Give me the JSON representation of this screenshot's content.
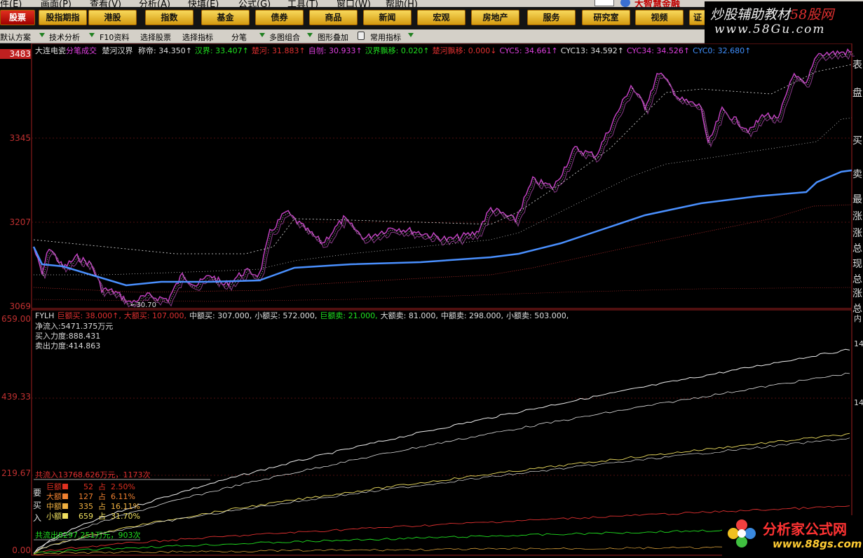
{
  "menubar": {
    "items": [
      "件(E)",
      "画面(P)",
      "查看(V)",
      "分析(A)",
      "快填(E)",
      "公式(G)",
      "工具(T)",
      "窗口(W)",
      "帮助(H)"
    ],
    "news": "大智慧金融"
  },
  "buttons": {
    "active": "股票",
    "items": [
      "股指期指",
      "港股",
      "指数",
      "基金",
      "债券",
      "商品",
      "新闻",
      "宏观",
      "房地产",
      "服务",
      "研究室",
      "视频",
      "证"
    ]
  },
  "toolbar": {
    "items": [
      "默认方案",
      "技术分析",
      "F10资料",
      "选择股票",
      "选择指标",
      "分笔",
      "多图组合",
      "图形叠加",
      "常用指标"
    ]
  },
  "watermark_top": {
    "line1_a": "炒股辅助教材",
    "line1_b": "58股网",
    "line2": "www.58Gu.com"
  },
  "watermark_bottom": {
    "title": "分析家公式网",
    "url": "www.88gs.com"
  },
  "price_panel": {
    "stock": "大连电瓷",
    "mode": "分笔成交",
    "indicator": "楚河汉界",
    "fields": [
      {
        "label": "称帝:",
        "value": "34.350",
        "arrow": "↑",
        "color": "#e0e0e0"
      },
      {
        "label": "汉界:",
        "value": "33.407",
        "arrow": "↑",
        "color": "#20e020"
      },
      {
        "label": "楚河:",
        "value": "31.883",
        "arrow": "↑",
        "color": "#e03030"
      },
      {
        "label": "自刎:",
        "value": "30.933",
        "arrow": "↑",
        "color": "#e040e0"
      },
      {
        "label": "汉界飘移:",
        "value": "0.020",
        "arrow": "↑",
        "color": "#20e020"
      },
      {
        "label": "楚河飘移:",
        "value": "0.000",
        "arrow": "↓",
        "color": "#e03030"
      },
      {
        "label": "CYC5:",
        "value": "34.661",
        "arrow": "↑",
        "color": "#e040e0"
      },
      {
        "label": "CYC13:",
        "value": "34.592",
        "arrow": "↑",
        "color": "#e0e0e0"
      },
      {
        "label": "CYC34:",
        "value": "34.526",
        "arrow": "↑",
        "color": "#e040e0"
      },
      {
        "label": "CYC0:",
        "value": "32.680",
        "arrow": "↑",
        "color": "#4090ff"
      }
    ],
    "yticks": [
      "3483",
      "3345",
      "3207",
      "3069"
    ],
    "low_label": "30.70",
    "side_text": [
      "表",
      "盘",
      "买",
      "卖",
      "最",
      "涨",
      "涨",
      "总",
      "现",
      "总",
      "涨",
      "总"
    ]
  },
  "flow_panel": {
    "header": [
      {
        "label": "FYLH",
        "value": "",
        "color": "#e0e0e0"
      },
      {
        "label": "巨额买:",
        "value": "38.000",
        "arrow": "↑",
        "color": "#e03030"
      },
      {
        "label": "大额买:",
        "value": "107.000",
        "arrow": "",
        "color": "#e03030"
      },
      {
        "label": "中额买:",
        "value": "307.000",
        "arrow": "",
        "color": "#e0e0e0"
      },
      {
        "label": "小额买:",
        "value": "572.000",
        "arrow": "",
        "color": "#e0e0e0"
      },
      {
        "label": "巨额卖:",
        "value": "21.000",
        "arrow": "",
        "color": "#20e020"
      },
      {
        "label": "大额卖:",
        "value": "81.000",
        "arrow": "",
        "color": "#e0e0e0"
      },
      {
        "label": "中额卖:",
        "value": "298.000",
        "arrow": "",
        "color": "#e0e0e0"
      },
      {
        "label": "小额卖:",
        "value": "503.000",
        "arrow": "",
        "color": "#e0e0e0"
      }
    ],
    "stats": [
      "净流入:5471.375万元",
      "买入力度:888.431",
      "卖出力度:414.863"
    ],
    "yticks": [
      "659.00",
      "439.33",
      "219.67",
      "0.00"
    ],
    "inflow_total": "共流入13768.626万元，1173次",
    "outflow_total": "共流出8297.251万元，903次",
    "buy_side_label": [
      "要",
      "买",
      "入"
    ],
    "buy_breakdown": [
      {
        "name": "巨额",
        "count": "52",
        "pct": "2.50%",
        "color": "#e03020"
      },
      {
        "name": "大额",
        "count": "127",
        "pct": "6.11%",
        "color": "#f08030"
      },
      {
        "name": "中额",
        "count": "335",
        "pct": "16.11%",
        "color": "#f0b040"
      },
      {
        "name": "小额",
        "count": "659",
        "pct": "31.70%",
        "color": "#f0e060"
      }
    ],
    "side_text": [
      "内",
      "14",
      "14"
    ]
  }
}
